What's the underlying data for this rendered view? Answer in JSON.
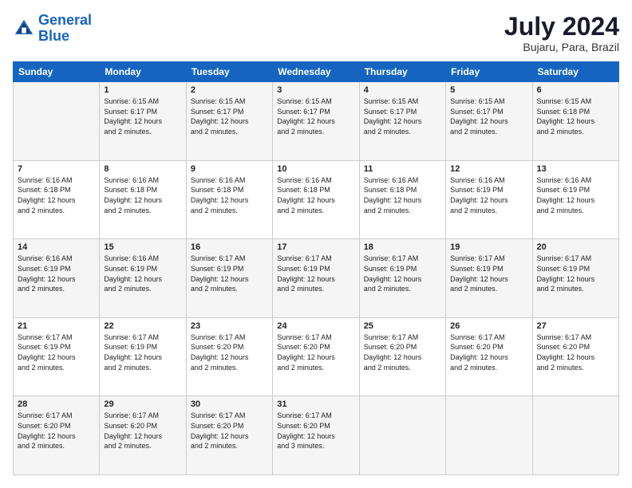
{
  "logo": {
    "line1": "General",
    "line2": "Blue"
  },
  "title": "July 2024",
  "subtitle": "Bujaru, Para, Brazil",
  "days_of_week": [
    "Sunday",
    "Monday",
    "Tuesday",
    "Wednesday",
    "Thursday",
    "Friday",
    "Saturday"
  ],
  "weeks": [
    [
      {
        "day": "",
        "info": ""
      },
      {
        "day": "1",
        "info": "Sunrise: 6:15 AM\nSunset: 6:17 PM\nDaylight: 12 hours\nand 2 minutes."
      },
      {
        "day": "2",
        "info": "Sunrise: 6:15 AM\nSunset: 6:17 PM\nDaylight: 12 hours\nand 2 minutes."
      },
      {
        "day": "3",
        "info": "Sunrise: 6:15 AM\nSunset: 6:17 PM\nDaylight: 12 hours\nand 2 minutes."
      },
      {
        "day": "4",
        "info": "Sunrise: 6:15 AM\nSunset: 6:17 PM\nDaylight: 12 hours\nand 2 minutes."
      },
      {
        "day": "5",
        "info": "Sunrise: 6:15 AM\nSunset: 6:17 PM\nDaylight: 12 hours\nand 2 minutes."
      },
      {
        "day": "6",
        "info": "Sunrise: 6:15 AM\nSunset: 6:18 PM\nDaylight: 12 hours\nand 2 minutes."
      }
    ],
    [
      {
        "day": "7",
        "info": "Sunrise: 6:16 AM\nSunset: 6:18 PM\nDaylight: 12 hours\nand 2 minutes."
      },
      {
        "day": "8",
        "info": "Sunrise: 6:16 AM\nSunset: 6:18 PM\nDaylight: 12 hours\nand 2 minutes."
      },
      {
        "day": "9",
        "info": "Sunrise: 6:16 AM\nSunset: 6:18 PM\nDaylight: 12 hours\nand 2 minutes."
      },
      {
        "day": "10",
        "info": "Sunrise: 6:16 AM\nSunset: 6:18 PM\nDaylight: 12 hours\nand 2 minutes."
      },
      {
        "day": "11",
        "info": "Sunrise: 6:16 AM\nSunset: 6:18 PM\nDaylight: 12 hours\nand 2 minutes."
      },
      {
        "day": "12",
        "info": "Sunrise: 6:16 AM\nSunset: 6:19 PM\nDaylight: 12 hours\nand 2 minutes."
      },
      {
        "day": "13",
        "info": "Sunrise: 6:16 AM\nSunset: 6:19 PM\nDaylight: 12 hours\nand 2 minutes."
      }
    ],
    [
      {
        "day": "14",
        "info": "Sunrise: 6:16 AM\nSunset: 6:19 PM\nDaylight: 12 hours\nand 2 minutes."
      },
      {
        "day": "15",
        "info": "Sunrise: 6:16 AM\nSunset: 6:19 PM\nDaylight: 12 hours\nand 2 minutes."
      },
      {
        "day": "16",
        "info": "Sunrise: 6:17 AM\nSunset: 6:19 PM\nDaylight: 12 hours\nand 2 minutes."
      },
      {
        "day": "17",
        "info": "Sunrise: 6:17 AM\nSunset: 6:19 PM\nDaylight: 12 hours\nand 2 minutes."
      },
      {
        "day": "18",
        "info": "Sunrise: 6:17 AM\nSunset: 6:19 PM\nDaylight: 12 hours\nand 2 minutes."
      },
      {
        "day": "19",
        "info": "Sunrise: 6:17 AM\nSunset: 6:19 PM\nDaylight: 12 hours\nand 2 minutes."
      },
      {
        "day": "20",
        "info": "Sunrise: 6:17 AM\nSunset: 6:19 PM\nDaylight: 12 hours\nand 2 minutes."
      }
    ],
    [
      {
        "day": "21",
        "info": "Sunrise: 6:17 AM\nSunset: 6:19 PM\nDaylight: 12 hours\nand 2 minutes."
      },
      {
        "day": "22",
        "info": "Sunrise: 6:17 AM\nSunset: 6:19 PM\nDaylight: 12 hours\nand 2 minutes."
      },
      {
        "day": "23",
        "info": "Sunrise: 6:17 AM\nSunset: 6:20 PM\nDaylight: 12 hours\nand 2 minutes."
      },
      {
        "day": "24",
        "info": "Sunrise: 6:17 AM\nSunset: 6:20 PM\nDaylight: 12 hours\nand 2 minutes."
      },
      {
        "day": "25",
        "info": "Sunrise: 6:17 AM\nSunset: 6:20 PM\nDaylight: 12 hours\nand 2 minutes."
      },
      {
        "day": "26",
        "info": "Sunrise: 6:17 AM\nSunset: 6:20 PM\nDaylight: 12 hours\nand 2 minutes."
      },
      {
        "day": "27",
        "info": "Sunrise: 6:17 AM\nSunset: 6:20 PM\nDaylight: 12 hours\nand 2 minutes."
      }
    ],
    [
      {
        "day": "28",
        "info": "Sunrise: 6:17 AM\nSunset: 6:20 PM\nDaylight: 12 hours\nand 2 minutes."
      },
      {
        "day": "29",
        "info": "Sunrise: 6:17 AM\nSunset: 6:20 PM\nDaylight: 12 hours\nand 2 minutes."
      },
      {
        "day": "30",
        "info": "Sunrise: 6:17 AM\nSunset: 6:20 PM\nDaylight: 12 hours\nand 2 minutes."
      },
      {
        "day": "31",
        "info": "Sunrise: 6:17 AM\nSunset: 6:20 PM\nDaylight: 12 hours\nand 3 minutes."
      },
      {
        "day": "",
        "info": ""
      },
      {
        "day": "",
        "info": ""
      },
      {
        "day": "",
        "info": ""
      }
    ]
  ]
}
